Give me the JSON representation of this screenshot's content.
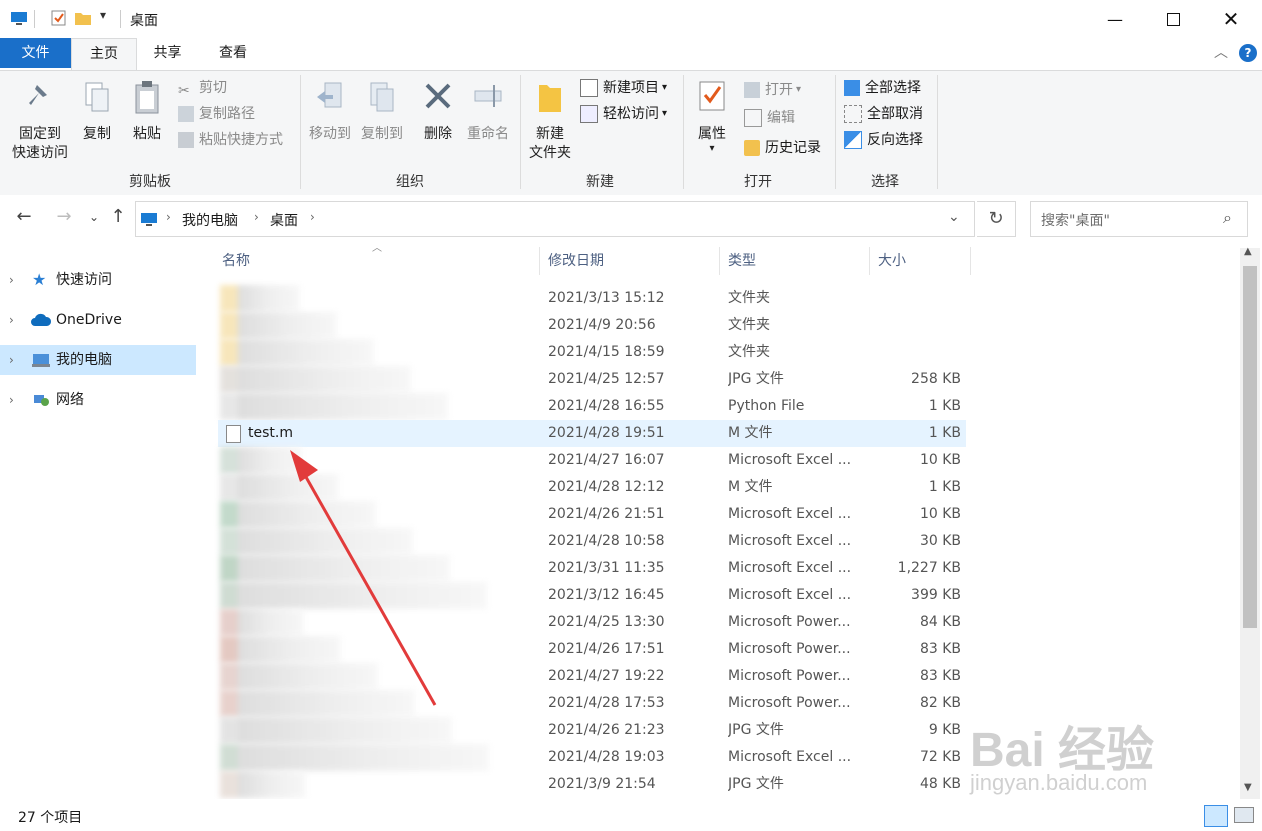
{
  "titlebar": {
    "title": "桌面",
    "minimize_icon": "minimize-icon",
    "maximize_icon": "maximize-icon",
    "close_icon": "close-icon"
  },
  "tabs": [
    {
      "label": "文件"
    },
    {
      "label": "主页"
    },
    {
      "label": "共享"
    },
    {
      "label": "查看"
    }
  ],
  "ribbon": {
    "clipboard": {
      "label": "剪贴板",
      "pin": "固定到\n快速访问",
      "copy": "复制",
      "paste": "粘贴",
      "cut": "剪切",
      "copy_path": "复制路径",
      "paste_shortcut": "粘贴快捷方式"
    },
    "organize": {
      "label": "组织",
      "move_to": "移动到",
      "copy_to": "复制到",
      "delete": "删除",
      "rename": "重命名"
    },
    "new": {
      "label": "新建",
      "new_folder": "新建\n文件夹",
      "new_item": "新建项目",
      "easy_access": "轻松访问"
    },
    "open": {
      "label": "打开",
      "properties": "属性",
      "open": "打开",
      "edit": "编辑",
      "history": "历史记录"
    },
    "select": {
      "label": "选择",
      "select_all": "全部选择",
      "select_none": "全部取消",
      "invert": "反向选择"
    }
  },
  "address": {
    "crumbs": [
      "我的电脑",
      "桌面"
    ],
    "search_placeholder": "搜索\"桌面\""
  },
  "navpane": {
    "items": [
      {
        "label": "快速访问",
        "icon": "star-icon"
      },
      {
        "label": "OneDrive",
        "icon": "cloud-icon"
      },
      {
        "label": "我的电脑",
        "icon": "computer-icon"
      },
      {
        "label": "网络",
        "icon": "network-icon"
      }
    ]
  },
  "columns": {
    "name": "名称",
    "date": "修改日期",
    "type": "类型",
    "size": "大小"
  },
  "files": [
    {
      "name": "",
      "date": "2021/3/13 15:12",
      "type": "文件夹",
      "size": "",
      "color": "#f6e2b0"
    },
    {
      "name": "",
      "date": "2021/4/9 20:56",
      "type": "文件夹",
      "size": "",
      "color": "#f6e2b0"
    },
    {
      "name": "",
      "date": "2021/4/15 18:59",
      "type": "文件夹",
      "size": "",
      "color": "#f6e2b0"
    },
    {
      "name": "",
      "date": "2021/4/25 12:57",
      "type": "JPG 文件",
      "size": "258 KB",
      "color": "#e0dcd8"
    },
    {
      "name": "",
      "date": "2021/4/28 16:55",
      "type": "Python File",
      "size": "1 KB",
      "color": "#e3e3e3"
    },
    {
      "name": "test.m",
      "date": "2021/4/28 19:51",
      "type": "M 文件",
      "size": "1 KB",
      "color": ""
    },
    {
      "name": "",
      "date": "2021/4/27 16:07",
      "type": "Microsoft Excel ...",
      "size": "10 KB",
      "color": "#cfdcd4"
    },
    {
      "name": "",
      "date": "2021/4/28 12:12",
      "type": "M 文件",
      "size": "1 KB",
      "color": "#e3e3e3"
    },
    {
      "name": "",
      "date": "2021/4/26 21:51",
      "type": "Microsoft Excel ...",
      "size": "10 KB",
      "color": "#b9d4c2"
    },
    {
      "name": "",
      "date": "2021/4/28 10:58",
      "type": "Microsoft Excel ...",
      "size": "30 KB",
      "color": "#cddcd2"
    },
    {
      "name": "",
      "date": "2021/3/31 11:35",
      "type": "Microsoft Excel ...",
      "size": "1,227 KB",
      "color": "#b6cfbd"
    },
    {
      "name": "",
      "date": "2021/3/12 16:45",
      "type": "Microsoft Excel ...",
      "size": "399 KB",
      "color": "#c7d6cb"
    },
    {
      "name": "",
      "date": "2021/4/25 13:30",
      "type": "Microsoft Power...",
      "size": "84 KB",
      "color": "#e2c7c2"
    },
    {
      "name": "",
      "date": "2021/4/26 17:51",
      "type": "Microsoft Power...",
      "size": "83 KB",
      "color": "#e0c0b8"
    },
    {
      "name": "",
      "date": "2021/4/27 19:22",
      "type": "Microsoft Power...",
      "size": "83 KB",
      "color": "#e3cdc8"
    },
    {
      "name": "",
      "date": "2021/4/28 17:53",
      "type": "Microsoft Power...",
      "size": "82 KB",
      "color": "#e4cac4"
    },
    {
      "name": "",
      "date": "2021/4/26 21:23",
      "type": "JPG 文件",
      "size": "9 KB",
      "color": "#dfdfdf"
    },
    {
      "name": "",
      "date": "2021/4/28 19:03",
      "type": "Microsoft Excel ...",
      "size": "72 KB",
      "color": "#c9d8cd"
    },
    {
      "name": "",
      "date": "2021/3/9 21:54",
      "type": "JPG 文件",
      "size": "48 KB",
      "color": "#e6dcd6"
    }
  ],
  "status": {
    "count": "27 个项目"
  },
  "watermark": {
    "brand": "Bai 经验",
    "url": "jingyan.baidu.com"
  },
  "colors": {
    "accent": "#1a6fc9",
    "selection": "#cce8ff",
    "row_highlight": "#e5f3ff",
    "arrow": "#e23b3b"
  }
}
